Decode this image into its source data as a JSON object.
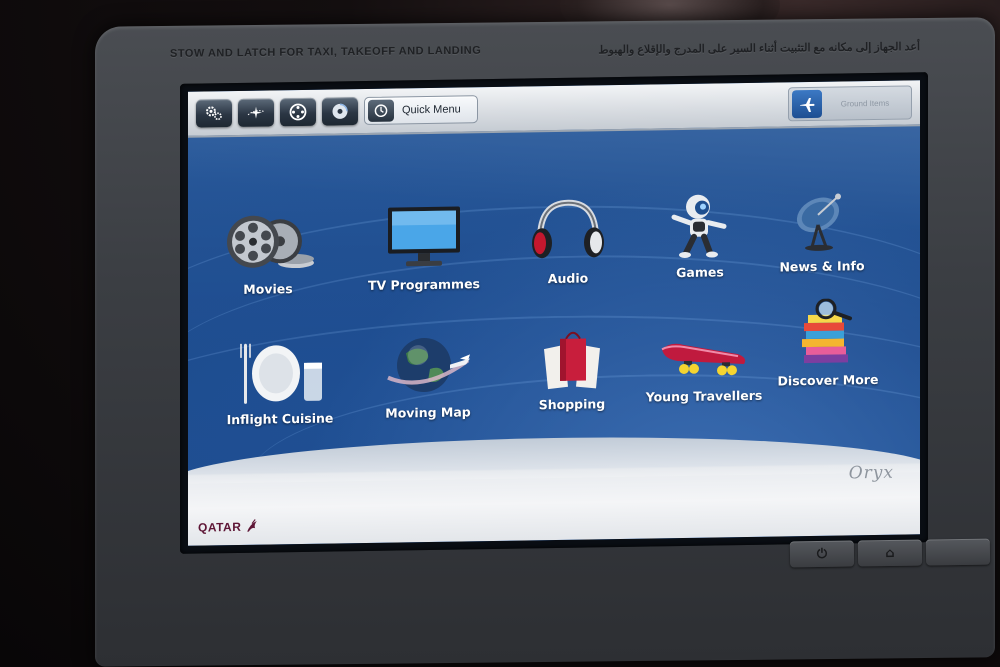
{
  "bezel": {
    "warning_en": "STOW AND LATCH FOR TAXI, TAKEOFF AND LANDING",
    "warning_ar": "أعد الجهاز إلى مكانه مع التثبيت أثناء السير على المدرج والإقلاع والهبوط"
  },
  "topbar": {
    "buttons": [
      {
        "icon": "settings-icon"
      },
      {
        "icon": "airplane-route-icon"
      },
      {
        "icon": "film-reel-icon"
      },
      {
        "icon": "disc-icon"
      }
    ],
    "quick_menu_label": "Quick Menu",
    "ground_icon": "airplane-icon",
    "ground_label": "Ground Items"
  },
  "menu": {
    "items": [
      {
        "label": "Movies",
        "icon": "film-reels-icon"
      },
      {
        "label": "TV Programmes",
        "icon": "tv-icon"
      },
      {
        "label": "Audio",
        "icon": "headphones-icon"
      },
      {
        "label": "Games",
        "icon": "robot-icon"
      },
      {
        "label": "News & Info",
        "icon": "satellite-dish-icon"
      },
      {
        "label": "Inflight Cuisine",
        "icon": "plate-cutlery-icon"
      },
      {
        "label": "Moving Map",
        "icon": "globe-plane-icon"
      },
      {
        "label": "Shopping",
        "icon": "shopping-bags-icon"
      },
      {
        "label": "Young Travellers",
        "icon": "skateboard-icon"
      },
      {
        "label": "Discover More",
        "icon": "books-magnifier-icon"
      }
    ]
  },
  "footer": {
    "brand": "QATAR",
    "product": "Oryx"
  },
  "colors": {
    "background_blue": "#2a5a9b",
    "topbar_silver": "#d9dde2",
    "label_white": "#ffffff",
    "qatar_maroon": "#5e1636"
  }
}
